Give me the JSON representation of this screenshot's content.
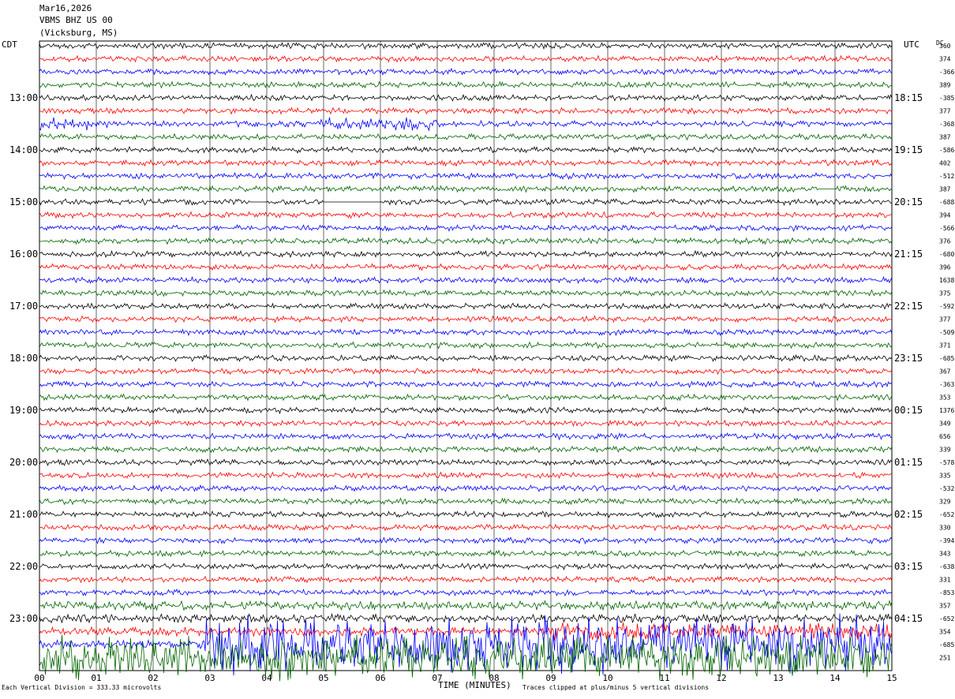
{
  "header": {
    "date": "Mar16,2026",
    "station": "VBMS BHZ US 00",
    "location": "(Vicksburg, MS)"
  },
  "left_axis_label": "CDT",
  "right_axis_label": "UTC",
  "dc_label": "DC",
  "footer": {
    "xlabel": "TIME (MINUTES)",
    "scale_note": "Each Vertical Division = 333.33 microvolts",
    "clip_note": "Traces clipped at plus/minus 5 vertical divisions"
  },
  "colors": {
    "trace_cycle": [
      "#000000",
      "#ff0000",
      "#0000ff",
      "#006400"
    ],
    "grid": "#000000"
  },
  "chart_data": {
    "type": "line",
    "title": "VBMS BHZ US 00",
    "xlabel": "TIME (MINUTES)",
    "xlim": [
      0,
      15
    ],
    "x_ticks": [
      "00",
      "01",
      "02",
      "03",
      "04",
      "05",
      "06",
      "07",
      "08",
      "09",
      "10",
      "11",
      "12",
      "13",
      "14",
      "15"
    ],
    "rows_count": 44,
    "row_interval_minutes": 15,
    "left_hour_labels": [
      "13:00",
      "14:00",
      "15:00",
      "16:00",
      "17:00",
      "18:00",
      "19:00",
      "20:00",
      "21:00",
      "22:00",
      "23:00"
    ],
    "right_hour_labels": [
      "18:15",
      "19:15",
      "20:15",
      "21:15",
      "22:15",
      "23:15",
      "00:15",
      "01:15",
      "02:15",
      "03:15",
      "04:15"
    ],
    "dc_offsets": [
      "360",
      "374",
      "-366",
      "389",
      "-385",
      "377",
      "-368",
      "387",
      "-586",
      "402",
      "-512",
      "387",
      "-688",
      "394",
      "-566",
      "376",
      "-680",
      "396",
      "1638",
      "375",
      "-592",
      "377",
      "-509",
      "371",
      "-685",
      "367",
      "-363",
      "353",
      "1376",
      "349",
      "656",
      "339",
      "-578",
      "335",
      "-532",
      "329",
      "-652",
      "330",
      "-394",
      "343",
      "-638",
      "331",
      "-853",
      "357"
    ],
    "dc_offsets_tail": [
      "-652",
      "354",
      "-685",
      "251"
    ],
    "gaps": [
      {
        "row": 12,
        "start_min": 3.7,
        "end_min": 4.0
      },
      {
        "row": 12,
        "start_min": 5.0,
        "end_min": 6.0
      },
      {
        "row": 11,
        "start_min": 13.7,
        "end_min": 14.0
      }
    ],
    "clip_divisions": 5,
    "microvolts_per_division": 333.33
  }
}
